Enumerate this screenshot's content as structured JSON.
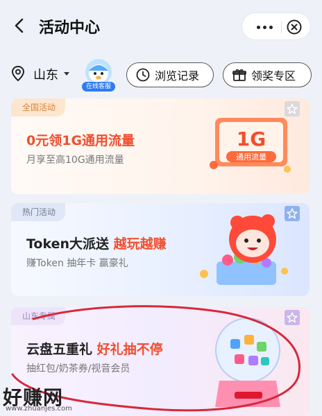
{
  "header": {
    "title": "活动中心",
    "back_icon": "chevron-left-icon",
    "more_icon": "more-dots-icon",
    "close_icon": "close-circle-icon"
  },
  "location_bar": {
    "location": "山东",
    "service_label": "在线客服",
    "history_label": "浏览记录",
    "prize_label": "领奖专区"
  },
  "cards": [
    {
      "tag": "全国活动",
      "title": "0元领1G通用流量",
      "subtitle": "月享至高10G通用流量",
      "badge_big": "1G",
      "badge_small": "通用流量"
    },
    {
      "tag": "热门活动",
      "title_main": "Token大派送",
      "title_highlight": "越玩越赚",
      "subtitle": "赚Token  抽年卡  赢豪礼"
    },
    {
      "tag": "山东专属",
      "title_main": "云盘五重礼",
      "title_highlight": "好礼抽不停",
      "subtitle": "抽红包/奶茶券/视音会员"
    }
  ],
  "watermark": {
    "logo": "好赚网",
    "url": "www.zhuanjes.com"
  },
  "colors": {
    "accent_red": "#f24e2e",
    "service_blue": "#2f7bf0",
    "scribble_red": "#d7283a"
  }
}
